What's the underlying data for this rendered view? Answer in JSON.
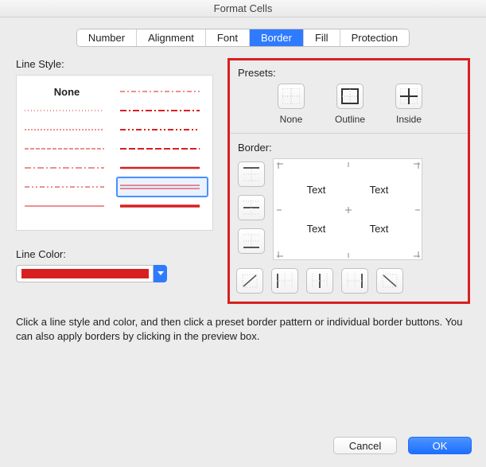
{
  "window": {
    "title": "Format Cells"
  },
  "tabs": {
    "items": [
      "Number",
      "Alignment",
      "Font",
      "Border",
      "Fill",
      "Protection"
    ],
    "active_index": 3
  },
  "left": {
    "line_style_label": "Line Style:",
    "none_label": "None",
    "line_color_label": "Line Color:",
    "line_color": "#d82020"
  },
  "right": {
    "presets_label": "Presets:",
    "presets": {
      "none": "None",
      "outline": "Outline",
      "inside": "Inside"
    },
    "border_label": "Border:",
    "preview_text": "Text"
  },
  "help_text": "Click a line style and color, and then click a preset border pattern or individual border buttons. You can also apply borders by clicking in the preview box.",
  "footer": {
    "cancel": "Cancel",
    "ok": "OK"
  },
  "highlight_color": "#d82020"
}
